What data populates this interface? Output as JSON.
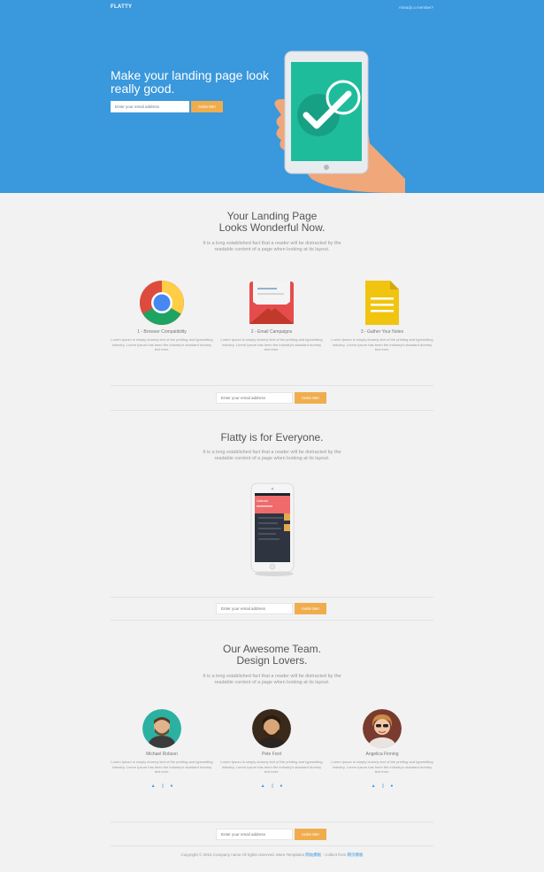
{
  "header": {
    "brand": "FLATTY",
    "member_link": "Already a member?"
  },
  "hero": {
    "title": "Make your landing page look really good.",
    "email_placeholder": "Enter your email address",
    "button": "Invite Me!"
  },
  "intro": {
    "title_line1": "Your Landing Page",
    "title_line2": "Looks Wonderful Now.",
    "text": "It is a long established fact that a reader will be distracted by the readable content of a page when looking at its layout."
  },
  "features": [
    {
      "icon": "chrome-icon",
      "title": "1 - Browser Compatibility",
      "text": "Lorem Ipsum is simply dummy text of the printing and typesetting industry. Lorem Ipsum has been the industry's standard dummy text ever."
    },
    {
      "icon": "envelope-icon",
      "title": "2 - Email Campaigns",
      "text": "Lorem Ipsum is simply dummy text of the printing and typesetting industry. Lorem Ipsum has been the industry's standard dummy text ever."
    },
    {
      "icon": "document-icon",
      "title": "3 - Gather Your Notes",
      "text": "Lorem Ipsum is simply dummy text of the printing and typesetting industry. Lorem Ipsum has been the industry's standard dummy text ever."
    }
  ],
  "cta": {
    "email_placeholder": "Enter your email address",
    "button": "Invite Me!"
  },
  "everyone": {
    "title": "Flatty is for Everyone.",
    "text": "It is a long established fact that a reader will be distracted by the readable content of a page when looking at its layout.",
    "phone_label": "Calendar"
  },
  "team": {
    "title_line1": "Our Awesome Team.",
    "title_line2": "Design Lovers.",
    "text": "It is a long established fact that a reader will be distracted by the readable content of a page when looking at its layout.",
    "members": [
      {
        "name": "Michael Robson",
        "text": "Lorem Ipsum is simply dummy text of the printing and typesetting industry. Lorem Ipsum has been the industry's standard dummy text ever."
      },
      {
        "name": "Pete Ford",
        "text": "Lorem Ipsum is simply dummy text of the printing and typesetting industry. Lorem Ipsum has been the industry's standard dummy text ever."
      },
      {
        "name": "Angelica Finning",
        "text": "Lorem Ipsum is simply dummy text of the printing and typesetting industry. Lorem Ipsum has been the industry's standard dummy text ever."
      }
    ],
    "social_icons": [
      "bar-chart-icon",
      "mobile-icon",
      "globe-icon"
    ]
  },
  "footer": {
    "text": "Copyright © 2016 Company name All rights reserved. More Templates",
    "link1": "网站模板",
    "separator": " - Collect from ",
    "link2": "网页模板"
  },
  "colors": {
    "hero_blue": "#3a98dc",
    "accent_orange": "#f0ad4e",
    "background": "#f2f2f2"
  }
}
